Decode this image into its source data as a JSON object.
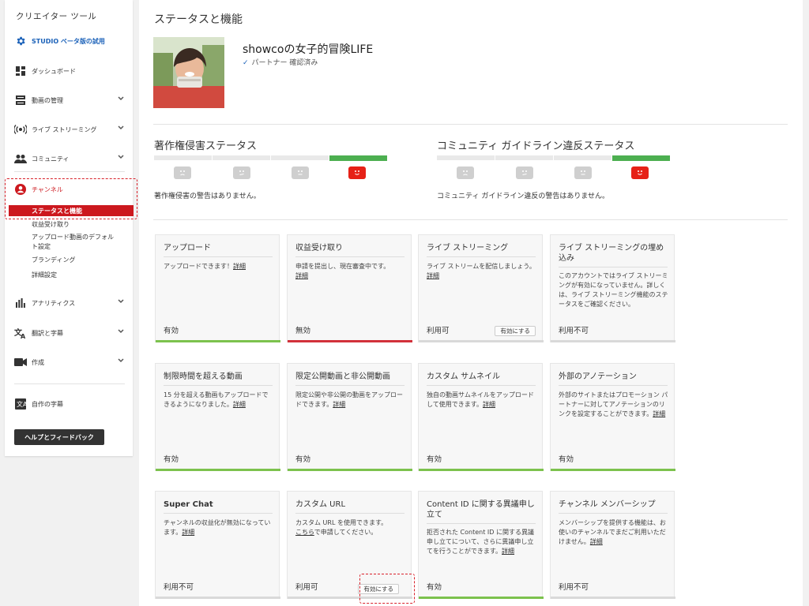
{
  "sidebar": {
    "title": "クリエイター ツール",
    "studio": "STUDIO ベータ版の試用",
    "dashboard": "ダッシュボード",
    "video_manager": "動画の管理",
    "live": "ライブ ストリーミング",
    "community": "コミュニティ",
    "channel": "チャンネル",
    "channel_sub": {
      "status": "ステータスと機能",
      "monetization": "収益受け取り",
      "upload_defaults": "アップロード動画のデフォルト設定",
      "branding": "ブランディング",
      "advanced": "詳細設定"
    },
    "analytics": "アナリティクス",
    "translations": "翻訳と字幕",
    "create": "作成",
    "your_subtitles": "自作の字幕",
    "help": "ヘルプとフィードバック"
  },
  "main": {
    "page_title": "ステータスと機能",
    "channel_name": "showcoの女子的冒険LIFE",
    "partner_status": "パートナー 確認済み",
    "copyright": {
      "title": "著作権侵害ステータス",
      "message": "著作権侵害の警告はありません。"
    },
    "community": {
      "title": "コミュニティ ガイドライン違反ステータス",
      "message": "コミュニティ ガイドライン違反の警告はありません。"
    },
    "enable_label": "有効にする",
    "detail_link": "詳細",
    "cards": [
      {
        "title": "アップロード",
        "desc": "アップロードできます！",
        "status": "有効"
      },
      {
        "title": "収益受け取り",
        "desc": "申請を提出し、現在審査中です。",
        "status": "無効"
      },
      {
        "title": "ライブ ストリーミング",
        "desc": "ライブ ストリームを配信しましょう。",
        "status": "利用可"
      },
      {
        "title": "ライブ ストリーミングの埋め込み",
        "desc": "このアカウントではライブ ストリーミングが有効になっていません。詳しくは、ライブ ストリーミング機能のステータスをご確認ください。",
        "status": "利用不可"
      },
      {
        "title": "制限時間を超える動画",
        "desc": "15 分を超える動画もアップロードできるようになりました。",
        "status": "有効"
      },
      {
        "title": "限定公開動画と非公開動画",
        "desc": "限定公開や非公開の動画をアップロードできます。",
        "status": "有効"
      },
      {
        "title": "カスタム サムネイル",
        "desc": "独自の動画サムネイルをアップロードして使用できます。",
        "status": "有効"
      },
      {
        "title": "外部のアノテーション",
        "desc": "外部のサイトまたはプロモーション パートナーに対してアノテーションのリンクを設定することができます。",
        "status": "有効"
      },
      {
        "title": "Super Chat",
        "desc": "チャンネルの収益化が無効になっています。",
        "status": "利用不可"
      },
      {
        "title": "カスタム URL",
        "desc": "カスタム URL を使用できます。",
        "link_pre": "こちら",
        "desc2": "で申請してください。",
        "status": "利用可"
      },
      {
        "title": "Content ID に関する異議申し立て",
        "desc": "拒否された Content ID に関する異議申し立てについて、さらに異議申し立てを行うことができます。",
        "status": "有効"
      },
      {
        "title": "チャンネル メンバーシップ",
        "desc": "メンバーシップを提供する機能は、お使いのチャンネルでまだご利用いただけません。",
        "status": "利用不可"
      }
    ]
  },
  "colors": {
    "red": "#cc181e",
    "green": "#7cc24d",
    "blue": "#1c62b9"
  }
}
